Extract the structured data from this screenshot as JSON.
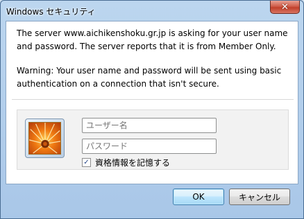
{
  "window": {
    "title": "Windows セキュリティ",
    "close_icon": "✕"
  },
  "message": {
    "line1": "The server www.aichikenshoku.gr.jp is asking for your user name and password. The server reports that it is from Member Only.",
    "line2": "Warning: Your user name and password will be sent using basic authentication on a connection that isn't secure."
  },
  "credentials": {
    "username_placeholder": "ユーザー名",
    "password_placeholder": "パスワード",
    "remember_label": "資格情報を記憶する",
    "remember_checked": true,
    "check_mark": "✓"
  },
  "buttons": {
    "ok_label": "OK",
    "cancel_label": "キャンセル"
  },
  "colors": {
    "close_button": "#c13f2a",
    "ok_button": "#bee6fd",
    "avatar_flower": "#f07a12"
  }
}
